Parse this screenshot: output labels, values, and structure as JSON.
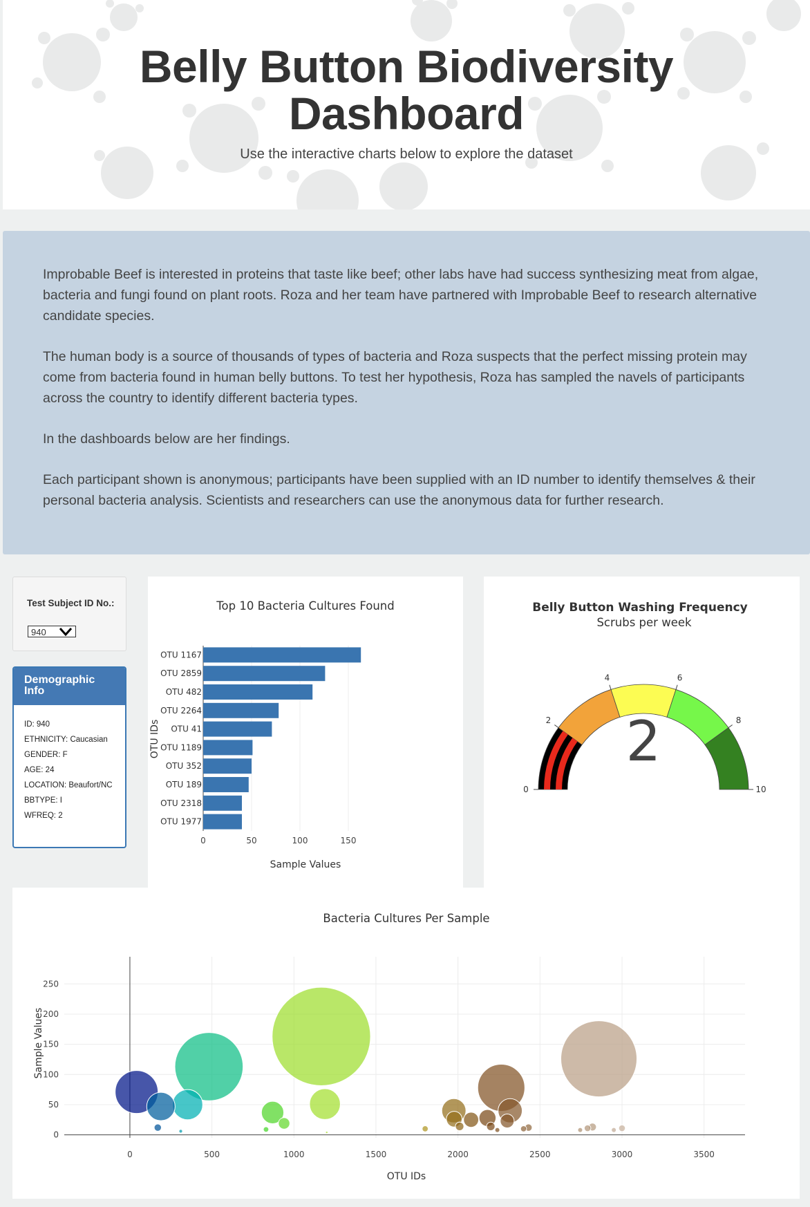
{
  "header": {
    "title_line1": "Belly Button Biodiversity",
    "title_line2": "Dashboard",
    "subtitle": "Use the interactive charts below to explore the dataset"
  },
  "intro": {
    "paragraphs": [
      "Improbable Beef is interested in proteins that taste like beef; other labs have had success synthesizing meat from algae, bacteria and fungi found on plant roots. Roza and her team have partnered with Improbable Beef to research alternative candidate species.",
      "The human body is a source of thousands of types of bacteria and Roza suspects that the perfect missing protein may come from bacteria found in human belly buttons. To test her hypothesis, Roza has sampled the navels of participants across the country to identify different bacteria types.",
      "In the dashboards below are her findings.",
      "Each participant shown is anonymous; participants have been supplied with an ID number to identify themselves & their personal bacteria analysis. Scientists and researchers can use the anonymous data for further research."
    ]
  },
  "selector": {
    "label": "Test Subject ID No.:",
    "value": "940"
  },
  "demographics": {
    "title": "Demographic Info",
    "items": [
      "ID: 940",
      "ETHNICITY: Caucasian",
      "GENDER: F",
      "AGE: 24",
      "LOCATION: Beaufort/NC",
      "BBTYPE: I",
      "WFREQ: 2"
    ]
  },
  "chart_data": [
    {
      "type": "bar",
      "orientation": "horizontal",
      "title": "Top 10 Bacteria Cultures Found",
      "xlabel": "Sample Values",
      "ylabel": "OTU IDs",
      "categories": [
        "OTU 1167",
        "OTU 2859",
        "OTU 482",
        "OTU 2264",
        "OTU 41",
        "OTU 1189",
        "OTU 352",
        "OTU 189",
        "OTU 2318",
        "OTU 1977"
      ],
      "values": [
        163,
        126,
        113,
        78,
        71,
        51,
        50,
        47,
        40,
        40
      ],
      "xlim": [
        0,
        175
      ],
      "xticks": [
        0,
        50,
        100,
        150
      ],
      "color": "#3a75b0"
    },
    {
      "type": "gauge",
      "title": "Belly Button Washing Frequency",
      "subtitle": "Scrubs per week",
      "value": 2,
      "range": [
        0,
        10
      ],
      "ticks": [
        0,
        2,
        4,
        6,
        8,
        10
      ],
      "steps": [
        {
          "range": [
            0,
            2
          ],
          "color": "#000000"
        },
        {
          "range": [
            2,
            4
          ],
          "color": "#f2a33a"
        },
        {
          "range": [
            4,
            6
          ],
          "color": "#fcfc53"
        },
        {
          "range": [
            6,
            8
          ],
          "color": "#76f74a"
        },
        {
          "range": [
            8,
            10
          ],
          "color": "#348121"
        }
      ],
      "bar_color": "#e8291c"
    },
    {
      "type": "scatter",
      "subtype": "bubble",
      "title": "Bacteria Cultures Per Sample",
      "xlabel": "OTU IDs",
      "ylabel": "Sample Values",
      "xlim": [
        -400,
        3750
      ],
      "ylim": [
        -5,
        295
      ],
      "xticks": [
        0,
        500,
        1000,
        1500,
        2000,
        2500,
        3000,
        3500
      ],
      "yticks": [
        0,
        50,
        100,
        150,
        200,
        250
      ],
      "colorscale": "Earth",
      "points": [
        {
          "x": 41,
          "y": 71
        },
        {
          "x": 189,
          "y": 47
        },
        {
          "x": 352,
          "y": 50
        },
        {
          "x": 482,
          "y": 113
        },
        {
          "x": 170,
          "y": 12
        },
        {
          "x": 310,
          "y": 6
        },
        {
          "x": 870,
          "y": 37
        },
        {
          "x": 940,
          "y": 19
        },
        {
          "x": 830,
          "y": 9
        },
        {
          "x": 1167,
          "y": 163
        },
        {
          "x": 1189,
          "y": 51
        },
        {
          "x": 1200,
          "y": 4
        },
        {
          "x": 1800,
          "y": 10
        },
        {
          "x": 1975,
          "y": 40
        },
        {
          "x": 1977,
          "y": 26
        },
        {
          "x": 2010,
          "y": 14
        },
        {
          "x": 2080,
          "y": 25
        },
        {
          "x": 2180,
          "y": 28
        },
        {
          "x": 2264,
          "y": 78
        },
        {
          "x": 2318,
          "y": 40
        },
        {
          "x": 2300,
          "y": 23
        },
        {
          "x": 2200,
          "y": 14
        },
        {
          "x": 2240,
          "y": 8
        },
        {
          "x": 2400,
          "y": 10
        },
        {
          "x": 2430,
          "y": 12
        },
        {
          "x": 2745,
          "y": 8
        },
        {
          "x": 2790,
          "y": 11
        },
        {
          "x": 2820,
          "y": 13
        },
        {
          "x": 2859,
          "y": 126
        },
        {
          "x": 2950,
          "y": 8
        },
        {
          "x": 3000,
          "y": 11
        }
      ]
    }
  ]
}
